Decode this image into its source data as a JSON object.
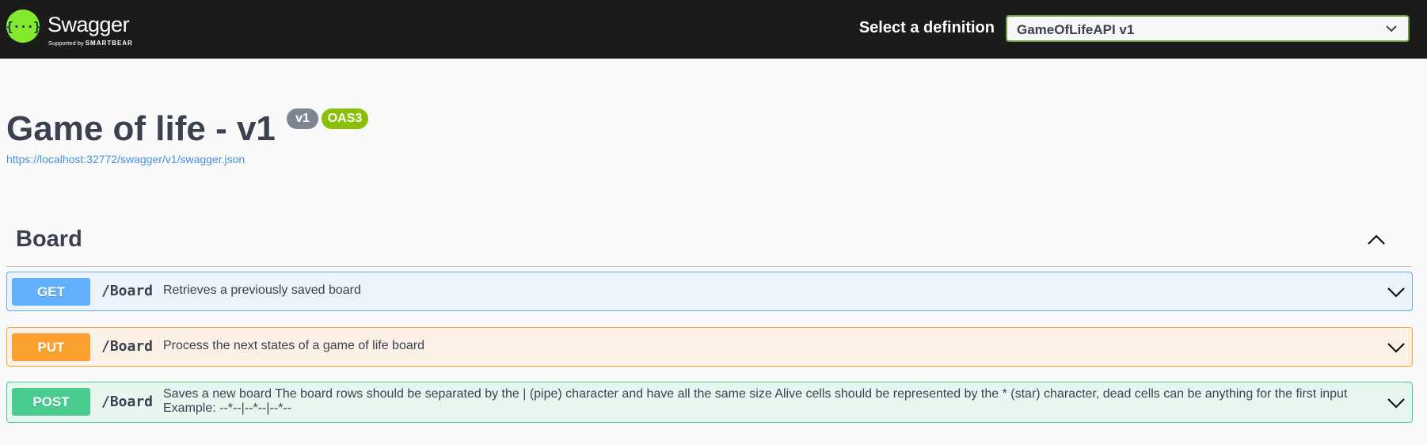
{
  "topbar": {
    "brand": "Swagger",
    "logo_glyph": "{···}",
    "supported_by": "Supported by",
    "sponsor": "SMARTBEAR",
    "definition_label": "Select a definition",
    "definition_value": "GameOfLifeAPI v1",
    "colors": {
      "background": "#1b1b1b",
      "logo": "#85ea2d",
      "select_border": "#62a03f"
    }
  },
  "info": {
    "title": "Game of life - v1",
    "version_badge": "v1",
    "oas_badge": "OAS3",
    "spec_url": "https://localhost:32772/swagger/v1/swagger.json"
  },
  "section": {
    "title": "Board",
    "toggle_icon": "chevron-up-icon",
    "operations": [
      {
        "method": "GET",
        "path": "/Board",
        "summary": "Retrieves a previously saved board",
        "color": "#61affe"
      },
      {
        "method": "PUT",
        "path": "/Board",
        "summary": "Process the next states of a game of life board",
        "color": "#fca130"
      },
      {
        "method": "POST",
        "path": "/Board",
        "summary": "Saves a new board The board rows should be separated by the | (pipe) character and have all the same size Alive cells should be represented by the * (star) character, dead cells can be anything for the first input",
        "summary_example": "Example: --*--|--*--|--*--",
        "color": "#49cc90"
      }
    ]
  }
}
